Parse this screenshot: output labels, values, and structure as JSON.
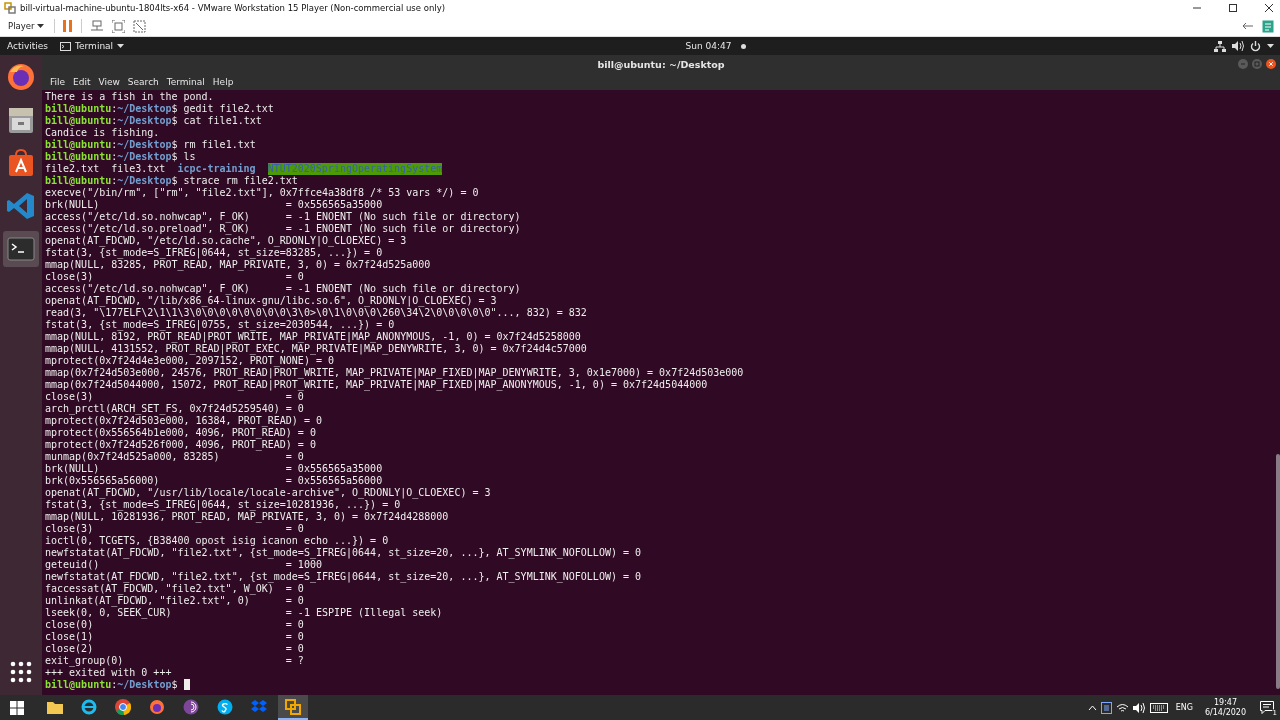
{
  "vm_window": {
    "title": "bill-virtual-machine-ubuntu-1804lts-x64 - VMware Workstation 15 Player (Non-commercial use only)",
    "player_menu": "Player"
  },
  "top_bar": {
    "activities": "Activities",
    "app_menu": "Terminal",
    "clock": "Sun 04:47"
  },
  "dock": {
    "items": [
      {
        "kind": "firefox",
        "selected": false
      },
      {
        "kind": "files",
        "selected": false
      },
      {
        "kind": "software",
        "selected": false
      },
      {
        "kind": "code",
        "selected": false
      },
      {
        "kind": "terminal",
        "selected": true
      }
    ]
  },
  "terminal": {
    "title": "bill@ubuntu: ~/Desktop",
    "menu": [
      "File",
      "Edit",
      "View",
      "Search",
      "Terminal",
      "Help"
    ],
    "lines": [
      {
        "kind": "output",
        "text": "There is a fish in the pond."
      },
      {
        "kind": "prompt",
        "user": "bill@ubuntu",
        "sep": ":",
        "path": "~/Desktop",
        "sign": "$",
        "command": "gedit file2.txt",
        "cursor": false
      },
      {
        "kind": "prompt",
        "user": "bill@ubuntu",
        "sep": ":",
        "path": "~/Desktop",
        "sign": "$",
        "command": "cat file1.txt",
        "cursor": false
      },
      {
        "kind": "output",
        "text": "Candice is fishing."
      },
      {
        "kind": "prompt",
        "user": "bill@ubuntu",
        "sep": ":",
        "path": "~/Desktop",
        "sign": "$",
        "command": "rm file1.txt",
        "cursor": false
      },
      {
        "kind": "prompt",
        "user": "bill@ubuntu",
        "sep": ":",
        "path": "~/Desktop",
        "sign": "$",
        "command": "ls",
        "cursor": false
      },
      {
        "kind": "listing",
        "entries": [
          {
            "kind": "file",
            "name": "file2.txt"
          },
          {
            "kind": "file",
            "name": "file3.txt"
          },
          {
            "kind": "dir",
            "name": "icpc-training"
          },
          {
            "kind": "shared_dir",
            "name": "NTUT2020SpringOperatingSystem"
          }
        ]
      },
      {
        "kind": "prompt",
        "user": "bill@ubuntu",
        "sep": ":",
        "path": "~/Desktop",
        "sign": "$",
        "command": "strace rm file2.txt",
        "cursor": false
      },
      {
        "kind": "output",
        "text": "execve(\"/bin/rm\", [\"rm\", \"file2.txt\"], 0x7ffce4a38df8 /* 53 vars */) = 0"
      },
      {
        "kind": "output",
        "text": "brk(NULL)                               = 0x556565a35000"
      },
      {
        "kind": "output",
        "text": "access(\"/etc/ld.so.nohwcap\", F_OK)      = -1 ENOENT (No such file or directory)"
      },
      {
        "kind": "output",
        "text": "access(\"/etc/ld.so.preload\", R_OK)      = -1 ENOENT (No such file or directory)"
      },
      {
        "kind": "output",
        "text": "openat(AT_FDCWD, \"/etc/ld.so.cache\", O_RDONLY|O_CLOEXEC) = 3"
      },
      {
        "kind": "output",
        "text": "fstat(3, {st_mode=S_IFREG|0644, st_size=83285, ...}) = 0"
      },
      {
        "kind": "output",
        "text": "mmap(NULL, 83285, PROT_READ, MAP_PRIVATE, 3, 0) = 0x7f24d525a000"
      },
      {
        "kind": "output",
        "text": "close(3)                                = 0"
      },
      {
        "kind": "output",
        "text": "access(\"/etc/ld.so.nohwcap\", F_OK)      = -1 ENOENT (No such file or directory)"
      },
      {
        "kind": "output",
        "text": "openat(AT_FDCWD, \"/lib/x86_64-linux-gnu/libc.so.6\", O_RDONLY|O_CLOEXEC) = 3"
      },
      {
        "kind": "output",
        "text": "read(3, \"\\177ELF\\2\\1\\1\\3\\0\\0\\0\\0\\0\\0\\0\\0\\3\\0>\\0\\1\\0\\0\\0\\260\\34\\2\\0\\0\\0\\0\\0\"..., 832) = 832"
      },
      {
        "kind": "output",
        "text": "fstat(3, {st_mode=S_IFREG|0755, st_size=2030544, ...}) = 0"
      },
      {
        "kind": "output",
        "text": "mmap(NULL, 8192, PROT_READ|PROT_WRITE, MAP_PRIVATE|MAP_ANONYMOUS, -1, 0) = 0x7f24d5258000"
      },
      {
        "kind": "output",
        "text": "mmap(NULL, 4131552, PROT_READ|PROT_EXEC, MAP_PRIVATE|MAP_DENYWRITE, 3, 0) = 0x7f24d4c57000"
      },
      {
        "kind": "output",
        "text": "mprotect(0x7f24d4e3e000, 2097152, PROT_NONE) = 0"
      },
      {
        "kind": "output",
        "text": "mmap(0x7f24d503e000, 24576, PROT_READ|PROT_WRITE, MAP_PRIVATE|MAP_FIXED|MAP_DENYWRITE, 3, 0x1e7000) = 0x7f24d503e000"
      },
      {
        "kind": "output",
        "text": "mmap(0x7f24d5044000, 15072, PROT_READ|PROT_WRITE, MAP_PRIVATE|MAP_FIXED|MAP_ANONYMOUS, -1, 0) = 0x7f24d5044000"
      },
      {
        "kind": "output",
        "text": "close(3)                                = 0"
      },
      {
        "kind": "output",
        "text": "arch_prctl(ARCH_SET_FS, 0x7f24d5259540) = 0"
      },
      {
        "kind": "output",
        "text": "mprotect(0x7f24d503e000, 16384, PROT_READ) = 0"
      },
      {
        "kind": "output",
        "text": "mprotect(0x556564b1e000, 4096, PROT_READ) = 0"
      },
      {
        "kind": "output",
        "text": "mprotect(0x7f24d526f000, 4096, PROT_READ) = 0"
      },
      {
        "kind": "output",
        "text": "munmap(0x7f24d525a000, 83285)           = 0"
      },
      {
        "kind": "output",
        "text": "brk(NULL)                               = 0x556565a35000"
      },
      {
        "kind": "output",
        "text": "brk(0x556565a56000)                     = 0x556565a56000"
      },
      {
        "kind": "output",
        "text": "openat(AT_FDCWD, \"/usr/lib/locale/locale-archive\", O_RDONLY|O_CLOEXEC) = 3"
      },
      {
        "kind": "output",
        "text": "fstat(3, {st_mode=S_IFREG|0644, st_size=10281936, ...}) = 0"
      },
      {
        "kind": "output",
        "text": "mmap(NULL, 10281936, PROT_READ, MAP_PRIVATE, 3, 0) = 0x7f24d4288000"
      },
      {
        "kind": "output",
        "text": "close(3)                                = 0"
      },
      {
        "kind": "output",
        "text": "ioctl(0, TCGETS, {B38400 opost isig icanon echo ...}) = 0"
      },
      {
        "kind": "output",
        "text": "newfstatat(AT_FDCWD, \"file2.txt\", {st_mode=S_IFREG|0644, st_size=20, ...}, AT_SYMLINK_NOFOLLOW) = 0"
      },
      {
        "kind": "output",
        "text": "geteuid()                               = 1000"
      },
      {
        "kind": "output",
        "text": "newfstatat(AT_FDCWD, \"file2.txt\", {st_mode=S_IFREG|0644, st_size=20, ...}, AT_SYMLINK_NOFOLLOW) = 0"
      },
      {
        "kind": "output",
        "text": "faccessat(AT_FDCWD, \"file2.txt\", W_OK)  = 0"
      },
      {
        "kind": "output",
        "text": "unlinkat(AT_FDCWD, \"file2.txt\", 0)      = 0"
      },
      {
        "kind": "output",
        "text": "lseek(0, 0, SEEK_CUR)                   = -1 ESPIPE (Illegal seek)"
      },
      {
        "kind": "output",
        "text": "close(0)                                = 0"
      },
      {
        "kind": "output",
        "text": "close(1)                                = 0"
      },
      {
        "kind": "output",
        "text": "close(2)                                = 0"
      },
      {
        "kind": "output",
        "text": "exit_group(0)                           = ?"
      },
      {
        "kind": "output",
        "text": "+++ exited with 0 +++"
      },
      {
        "kind": "prompt",
        "user": "bill@ubuntu",
        "sep": ":",
        "path": "~/Desktop",
        "sign": "$",
        "cursor": true
      }
    ]
  },
  "taskbar": {
    "apps": [
      {
        "kind": "folder",
        "selected": false
      },
      {
        "kind": "ie",
        "selected": false
      },
      {
        "kind": "chrome",
        "selected": false
      },
      {
        "kind": "firefox",
        "selected": false
      },
      {
        "kind": "tor",
        "selected": false
      },
      {
        "kind": "skype",
        "selected": false
      },
      {
        "kind": "dropbox",
        "selected": false
      },
      {
        "kind": "vmware",
        "selected": true
      }
    ],
    "language": "ENG",
    "time": "19:47",
    "date": "6/14/2020",
    "notification_count": "1"
  }
}
